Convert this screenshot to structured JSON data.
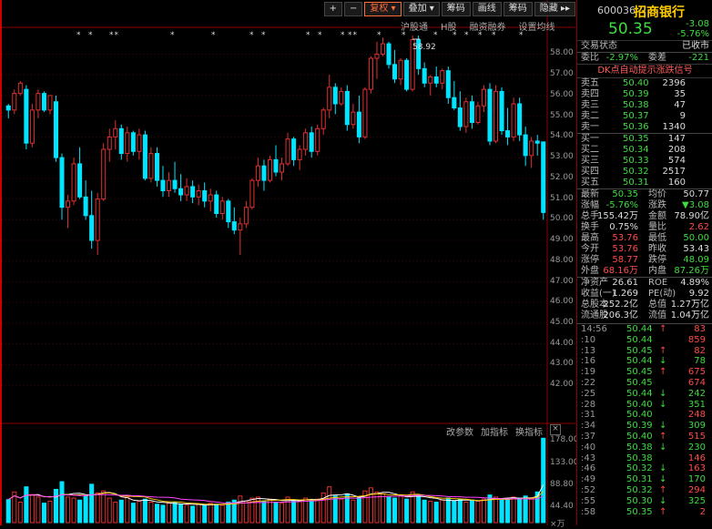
{
  "toolbar": {
    "buttons": [
      "+",
      "−",
      "复权 ▾",
      "叠加 ▾",
      "筹码",
      "画线",
      "筹码",
      "隐藏 ▸▸"
    ]
  },
  "subtabs": [
    "沪股通",
    "H股",
    "融资融券",
    "设置均线"
  ],
  "volume_toolbar": [
    "改参数",
    "加指标",
    "换指标",
    "×"
  ],
  "chart_labels": {
    "high_marker": "58.92",
    "price_ticks": [
      "58.00",
      "57.00",
      "56.00",
      "55.00",
      "54.00",
      "53.00",
      "52.00",
      "51.00",
      "50.00",
      "49.00",
      "48.00",
      "47.00",
      "46.00",
      "45.00",
      "44.00",
      "43.00",
      "42.00"
    ],
    "volume_ticks": [
      "178.00",
      "133.00",
      "88.80",
      "44.40",
      "×万"
    ],
    "event_markers": [
      "*",
      "*",
      "**",
      "*",
      "*",
      "*",
      "*",
      "*",
      "*",
      "*",
      "**",
      "*",
      "*",
      "*",
      "*",
      "*",
      "*",
      "*",
      "*"
    ]
  },
  "chart_data": {
    "type": "candlestick",
    "ylim": [
      41.7,
      58.9
    ],
    "volume_ylim": [
      0,
      178
    ],
    "candles": [
      [
        55.5,
        55.6,
        54.9,
        55.3
      ],
      [
        55.3,
        56.3,
        55.1,
        56.1
      ],
      [
        56.1,
        56.7,
        56.0,
        56.6
      ],
      [
        56.3,
        56.5,
        53.4,
        53.7
      ],
      [
        53.7,
        55.6,
        53.5,
        55.3
      ],
      [
        55.3,
        56.3,
        54.9,
        56.1
      ],
      [
        56.1,
        56.2,
        55.2,
        55.3
      ],
      [
        55.3,
        56.0,
        55.1,
        56.0
      ],
      [
        55.7,
        56.0,
        52.8,
        53.0
      ],
      [
        53.0,
        53.2,
        50.0,
        50.6
      ],
      [
        50.6,
        51.2,
        49.6,
        50.9
      ],
      [
        50.9,
        53.0,
        50.7,
        52.7
      ],
      [
        52.7,
        53.5,
        51.0,
        51.1
      ],
      [
        51.1,
        51.9,
        50.0,
        50.2
      ],
      [
        50.2,
        51.4,
        48.6,
        49.0
      ],
      [
        49.0,
        51.3,
        48.3,
        51.0
      ],
      [
        51.0,
        53.7,
        50.9,
        53.4
      ],
      [
        53.4,
        54.4,
        52.8,
        54.0
      ],
      [
        54.0,
        54.8,
        53.4,
        54.4
      ],
      [
        54.4,
        54.6,
        52.9,
        53.2
      ],
      [
        53.2,
        54.5,
        52.8,
        54.2
      ],
      [
        54.2,
        54.3,
        53.1,
        53.3
      ],
      [
        53.3,
        54.4,
        52.9,
        54.1
      ],
      [
        54.1,
        54.3,
        51.9,
        52.0
      ],
      [
        52.0,
        53.5,
        51.8,
        53.2
      ],
      [
        53.2,
        53.5,
        51.6,
        51.9
      ],
      [
        51.9,
        52.6,
        51.1,
        51.4
      ],
      [
        51.4,
        52.3,
        51.1,
        51.9
      ],
      [
        51.9,
        52.8,
        51.3,
        51.5
      ],
      [
        51.5,
        52.2,
        50.9,
        51.2
      ],
      [
        51.2,
        52.0,
        50.9,
        51.6
      ],
      [
        51.6,
        51.9,
        50.8,
        51.1
      ],
      [
        51.1,
        51.7,
        50.7,
        51.4
      ],
      [
        51.4,
        51.8,
        50.6,
        50.9
      ],
      [
        50.9,
        51.5,
        50.4,
        51.2
      ],
      [
        51.2,
        51.4,
        50.1,
        50.3
      ],
      [
        50.3,
        51.1,
        50.0,
        50.9
      ],
      [
        50.9,
        51.0,
        49.6,
        49.9
      ],
      [
        49.9,
        50.6,
        49.3,
        49.5
      ],
      [
        49.5,
        50.1,
        48.3,
        49.8
      ],
      [
        49.8,
        50.9,
        49.6,
        50.6
      ],
      [
        50.6,
        52.0,
        50.5,
        51.9
      ],
      [
        51.9,
        53.0,
        51.6,
        52.6
      ],
      [
        52.6,
        52.9,
        51.4,
        51.9
      ],
      [
        51.9,
        53.1,
        51.8,
        52.9
      ],
      [
        52.9,
        53.6,
        52.1,
        52.3
      ],
      [
        52.3,
        53.0,
        51.9,
        52.7
      ],
      [
        52.7,
        54.2,
        52.6,
        53.9
      ],
      [
        53.9,
        54.0,
        52.6,
        52.9
      ],
      [
        52.9,
        53.6,
        52.4,
        53.4
      ],
      [
        53.4,
        54.4,
        53.1,
        54.2
      ],
      [
        54.2,
        54.5,
        53.0,
        53.3
      ],
      [
        53.3,
        54.6,
        53.1,
        54.4
      ],
      [
        54.4,
        55.4,
        54.1,
        55.3
      ],
      [
        55.3,
        57.0,
        54.9,
        56.4
      ],
      [
        56.4,
        56.6,
        55.1,
        55.6
      ],
      [
        55.6,
        56.4,
        55.5,
        56.2
      ],
      [
        56.2,
        56.5,
        54.3,
        54.6
      ],
      [
        54.6,
        55.6,
        54.4,
        55.2
      ],
      [
        55.2,
        56.0,
        53.7,
        54.0
      ],
      [
        54.0,
        56.4,
        53.9,
        56.3
      ],
      [
        56.3,
        57.9,
        56.1,
        57.8
      ],
      [
        57.8,
        58.6,
        56.8,
        58.0
      ],
      [
        58.0,
        58.8,
        57.9,
        58.5
      ],
      [
        58.5,
        58.6,
        57.3,
        57.5
      ],
      [
        57.5,
        58.2,
        56.6,
        56.8
      ],
      [
        56.8,
        57.8,
        56.5,
        57.7
      ],
      [
        57.7,
        57.8,
        56.2,
        56.3
      ],
      [
        56.3,
        58.9,
        56.2,
        58.7
      ],
      [
        58.7,
        58.9,
        57.0,
        57.3
      ],
      [
        57.3,
        57.6,
        56.4,
        56.6
      ],
      [
        56.6,
        57.0,
        56.0,
        56.9
      ],
      [
        56.9,
        57.4,
        56.4,
        56.6
      ],
      [
        56.6,
        57.3,
        56.3,
        57.2
      ],
      [
        57.2,
        57.4,
        55.6,
        55.9
      ],
      [
        55.9,
        56.7,
        55.3,
        55.4
      ],
      [
        55.4,
        56.2,
        54.3,
        54.5
      ],
      [
        54.5,
        55.9,
        54.2,
        55.7
      ],
      [
        55.7,
        56.0,
        54.4,
        54.7
      ],
      [
        54.7,
        55.7,
        54.6,
        55.5
      ],
      [
        55.5,
        56.5,
        55.2,
        56.3
      ],
      [
        56.3,
        56.6,
        53.6,
        53.8
      ],
      [
        53.8,
        56.5,
        53.7,
        56.2
      ],
      [
        56.2,
        56.4,
        54.1,
        54.3
      ],
      [
        54.3,
        55.4,
        53.6,
        54.0
      ],
      [
        54.0,
        55.9,
        53.8,
        55.6
      ],
      [
        55.6,
        55.9,
        53.8,
        54.1
      ],
      [
        54.1,
        54.5,
        52.6,
        53.1
      ],
      [
        53.1,
        54.0,
        52.5,
        53.8
      ],
      [
        53.8,
        54.1,
        53.1,
        53.7
      ],
      [
        53.76,
        53.76,
        50.0,
        50.35
      ]
    ],
    "volumes": [
      45,
      60,
      40,
      70,
      55,
      50,
      38,
      42,
      65,
      80,
      50,
      48,
      44,
      52,
      75,
      58,
      62,
      48,
      40,
      44,
      50,
      38,
      42,
      46,
      40,
      36,
      34,
      38,
      40,
      36,
      34,
      32,
      36,
      34,
      38,
      36,
      34,
      40,
      44,
      52,
      42,
      48,
      50,
      42,
      46,
      40,
      38,
      50,
      44,
      42,
      48,
      44,
      46,
      58,
      70,
      52,
      46,
      56,
      44,
      50,
      62,
      68,
      60,
      56,
      50,
      48,
      52,
      46,
      60,
      52,
      44,
      42,
      40,
      44,
      48,
      42,
      46,
      40,
      44,
      42,
      46,
      54,
      50,
      44,
      46,
      50,
      48,
      52,
      46,
      60,
      165
    ]
  },
  "quote": {
    "code": "600036",
    "name": "招商银行",
    "price": "50.35",
    "change": "-3.08",
    "change_pct": "-5.76%",
    "status_label": "交易状态",
    "status_value": "已收市",
    "weibi_label": "委比",
    "weibi": "-2.97%",
    "weicha_label": "委差",
    "weicha": "-221",
    "dk_signal": "DK点自动提示涨跌信号",
    "sell": [
      {
        "label": "卖五",
        "price": "50.40",
        "vol": "2396"
      },
      {
        "label": "卖四",
        "price": "50.39",
        "vol": "35"
      },
      {
        "label": "卖三",
        "price": "50.38",
        "vol": "47"
      },
      {
        "label": "卖二",
        "price": "50.37",
        "vol": "9"
      },
      {
        "label": "卖一",
        "price": "50.36",
        "vol": "1340"
      }
    ],
    "buy": [
      {
        "label": "买一",
        "price": "50.35",
        "vol": "147"
      },
      {
        "label": "买二",
        "price": "50.34",
        "vol": "208"
      },
      {
        "label": "买三",
        "price": "50.33",
        "vol": "574"
      },
      {
        "label": "买四",
        "price": "50.32",
        "vol": "2517"
      },
      {
        "label": "买五",
        "price": "50.31",
        "vol": "160"
      }
    ],
    "stats": [
      {
        "l1": "最新",
        "v1": "50.35",
        "c1": "green",
        "l2": "均价",
        "v2": "50.77",
        "c2": "white"
      },
      {
        "l1": "涨幅",
        "v1": "-5.76%",
        "c1": "green",
        "l2": "涨跌",
        "v2": "▼3.08",
        "c2": "green"
      },
      {
        "l1": "总手",
        "v1": "155.42万",
        "c1": "white",
        "l2": "金额",
        "v2": "78.90亿",
        "c2": "white"
      },
      {
        "l1": "换手",
        "v1": "0.75%",
        "c1": "white",
        "l2": "量比",
        "v2": "2.62",
        "c2": "red"
      },
      {
        "l1": "最高",
        "v1": "53.76",
        "c1": "red",
        "l2": "最低",
        "v2": "50.00",
        "c2": "green"
      },
      {
        "l1": "今开",
        "v1": "53.76",
        "c1": "red",
        "l2": "昨收",
        "v2": "53.43",
        "c2": "white"
      },
      {
        "l1": "涨停",
        "v1": "58.77",
        "c1": "red",
        "l2": "跌停",
        "v2": "48.09",
        "c2": "green"
      },
      {
        "l1": "外盘",
        "v1": "68.16万",
        "c1": "red",
        "l2": "内盘",
        "v2": "87.26万",
        "c2": "green"
      }
    ],
    "fundamentals": [
      {
        "l1": "净资产",
        "v1": "26.61",
        "l2": "ROE",
        "v2": "4.89%"
      },
      {
        "l1": "收益(一)",
        "v1": "1.269",
        "l2": "PE(动)",
        "v2": "9.92"
      },
      {
        "l1": "总股本",
        "v1": "252.2亿",
        "l2": "总值",
        "v2": "1.27万亿"
      },
      {
        "l1": "流通股",
        "v1": "206.3亿",
        "l2": "流值",
        "v2": "1.04万亿"
      }
    ],
    "ticks": [
      {
        "t": "14:56",
        "p": "50.44",
        "a": "↑",
        "pc": "green",
        "ac": "red",
        "v": "83",
        "vc": "red"
      },
      {
        "t": ":10",
        "p": "50.44",
        "a": "",
        "pc": "green",
        "ac": "red",
        "v": "859",
        "vc": "red"
      },
      {
        "t": ":13",
        "p": "50.45",
        "a": "↑",
        "pc": "green",
        "ac": "red",
        "v": "82",
        "vc": "red"
      },
      {
        "t": ":16",
        "p": "50.44",
        "a": "↓",
        "pc": "green",
        "ac": "green",
        "v": "78",
        "vc": "green"
      },
      {
        "t": ":19",
        "p": "50.45",
        "a": "↑",
        "pc": "green",
        "ac": "red",
        "v": "675",
        "vc": "red"
      },
      {
        "t": ":22",
        "p": "50.45",
        "a": "",
        "pc": "green",
        "ac": "red",
        "v": "674",
        "vc": "red"
      },
      {
        "t": ":25",
        "p": "50.44",
        "a": "↓",
        "pc": "green",
        "ac": "green",
        "v": "242",
        "vc": "green"
      },
      {
        "t": ":28",
        "p": "50.40",
        "a": "↓",
        "pc": "green",
        "ac": "green",
        "v": "351",
        "vc": "green"
      },
      {
        "t": ":31",
        "p": "50.40",
        "a": "",
        "pc": "green",
        "ac": "red",
        "v": "248",
        "vc": "red"
      },
      {
        "t": ":34",
        "p": "50.39",
        "a": "↓",
        "pc": "green",
        "ac": "green",
        "v": "309",
        "vc": "green"
      },
      {
        "t": ":37",
        "p": "50.40",
        "a": "↑",
        "pc": "green",
        "ac": "red",
        "v": "515",
        "vc": "red"
      },
      {
        "t": ":40",
        "p": "50.38",
        "a": "↓",
        "pc": "green",
        "ac": "green",
        "v": "230",
        "vc": "green"
      },
      {
        "t": ":43",
        "p": "50.38",
        "a": "",
        "pc": "green",
        "ac": "red",
        "v": "146",
        "vc": "red"
      },
      {
        "t": ":46",
        "p": "50.32",
        "a": "↓",
        "pc": "green",
        "ac": "green",
        "v": "163",
        "vc": "red"
      },
      {
        "t": ":49",
        "p": "50.31",
        "a": "↓",
        "pc": "green",
        "ac": "green",
        "v": "170",
        "vc": "green"
      },
      {
        "t": ":52",
        "p": "50.32",
        "a": "↑",
        "pc": "green",
        "ac": "red",
        "v": "294",
        "vc": "red"
      },
      {
        "t": ":55",
        "p": "50.30",
        "a": "↓",
        "pc": "green",
        "ac": "green",
        "v": "325",
        "vc": "green"
      },
      {
        "t": ":58",
        "p": "50.35",
        "a": "↑",
        "pc": "green",
        "ac": "red",
        "v": "2",
        "vc": "red"
      }
    ]
  },
  "colors": {
    "up": "#e03030",
    "down": "#00e5ff",
    "ma": "#ffcc00",
    "ma2": "#ff44ff",
    "ma3": "#ffffff"
  }
}
